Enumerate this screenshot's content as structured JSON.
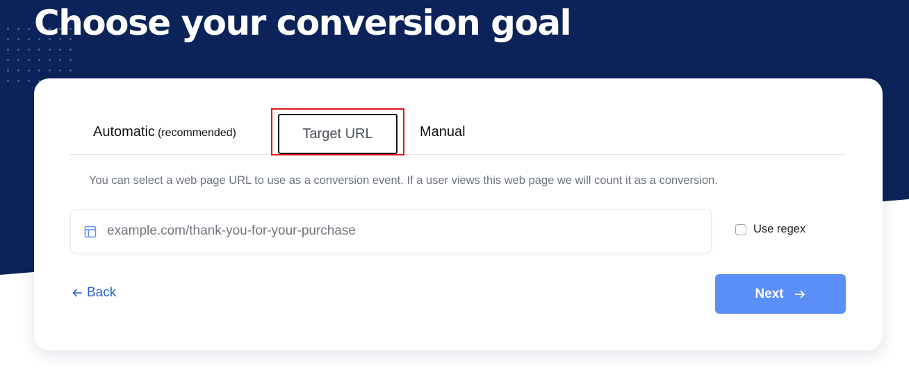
{
  "page": {
    "title": "Choose your conversion goal"
  },
  "colors": {
    "hero_background": "#0b2359",
    "highlight_border": "#e0141b",
    "link": "#2563d9",
    "primary_button": "#5b8ff8"
  },
  "tabs": {
    "automatic_label": "Automatic",
    "automatic_hint": "(recommended)",
    "target_url_label": "Target URL",
    "manual_label": "Manual",
    "selected": "Target URL"
  },
  "target_url": {
    "description": "You can select a web page URL to use as a conversion event. If a user views this web page we will count it as a conversion.",
    "input_value": "",
    "input_placeholder": "example.com/thank-you-for-your-purchase",
    "input_icon": "page-layout-icon",
    "regex_label": "Use regex",
    "regex_checked": false
  },
  "footer": {
    "back_label": "Back",
    "next_label": "Next"
  }
}
